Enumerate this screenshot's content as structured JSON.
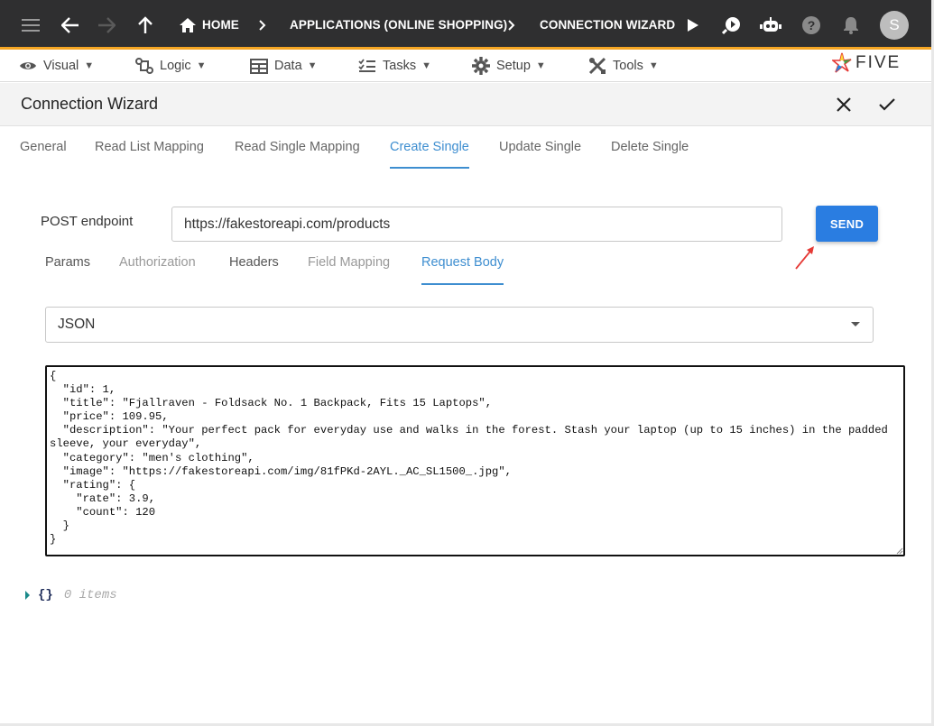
{
  "breadcrumbs": {
    "home": "HOME",
    "application": "APPLICATIONS (ONLINE SHOPPING)",
    "current": "CONNECTION WIZARD"
  },
  "user": {
    "avatar_initial": "S"
  },
  "menu": [
    {
      "label": "Visual",
      "icon": "eye-icon"
    },
    {
      "label": "Logic",
      "icon": "flow-icon"
    },
    {
      "label": "Data",
      "icon": "table-icon"
    },
    {
      "label": "Tasks",
      "icon": "checklist-icon"
    },
    {
      "label": "Setup",
      "icon": "gear-icon"
    },
    {
      "label": "Tools",
      "icon": "wrench-icon"
    }
  ],
  "logo": {
    "text": "FIVE"
  },
  "page": {
    "title": "Connection Wizard"
  },
  "tabs": [
    "General",
    "Read List Mapping",
    "Read Single Mapping",
    "Create Single",
    "Update Single",
    "Delete Single"
  ],
  "active_tab": "Create Single",
  "endpoint": {
    "label": "POST endpoint",
    "value": "https://fakestoreapi.com/products",
    "send_label": "SEND"
  },
  "subtabs": [
    "Params",
    "Authorization",
    "Headers",
    "Field Mapping",
    "Request Body"
  ],
  "active_subtab": "Request Body",
  "body_format": {
    "selected": "JSON"
  },
  "request_body": "{\n  \"id\": 1,\n  \"title\": \"Fjallraven - Foldsack No. 1 Backpack, Fits 15 Laptops\",\n  \"price\": 109.95,\n  \"description\": \"Your perfect pack for everyday use and walks in the forest. Stash your laptop (up to 15 inches) in the padded sleeve, your everyday\",\n  \"category\": \"men's clothing\",\n  \"image\": \"https://fakestoreapi.com/img/81fPKd-2AYL._AC_SL1500_.jpg\",\n  \"rating\": {\n    \"rate\": 3.9,\n    \"count\": 120\n  }\n}",
  "response_tree": {
    "braces": "{}",
    "count_text": "0 items"
  },
  "colors": {
    "accent": "#3e8ed0",
    "send": "#2a7de1",
    "topbar": "#2f2f30",
    "topbar_border": "#f5a623"
  }
}
